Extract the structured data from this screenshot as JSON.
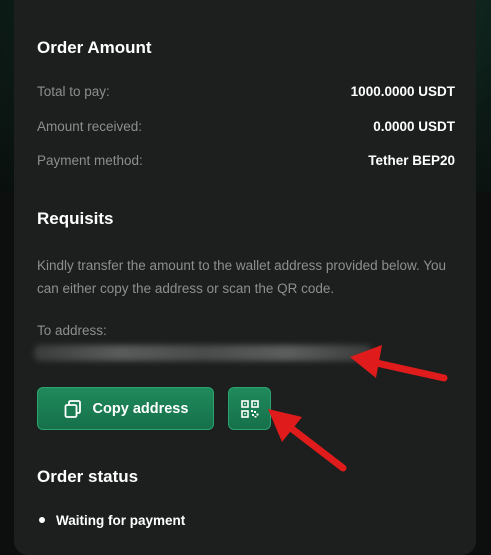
{
  "order_amount": {
    "title": "Order Amount",
    "rows": [
      {
        "label": "Total to pay:",
        "value": "1000.0000 USDT"
      },
      {
        "label": "Amount received:",
        "value": "0.0000 USDT"
      },
      {
        "label": "Payment method:",
        "value": "Tether BEP20"
      }
    ]
  },
  "requisits": {
    "title": "Requisits",
    "description": "Kindly transfer the amount to the wallet address provided below. You can either copy the address or scan the QR code.",
    "address_label": "To address:",
    "copy_button_label": "Copy address",
    "copy_icon": "copy-icon",
    "qr_icon": "qr-code-icon"
  },
  "order_status": {
    "title": "Order status",
    "items": [
      "Waiting for payment"
    ]
  },
  "colors": {
    "accent": "#1f8a5c",
    "card_bg": "#1d1f1f",
    "muted_text": "#8b8f8e",
    "annotation_arrow": "#e01b1b"
  }
}
